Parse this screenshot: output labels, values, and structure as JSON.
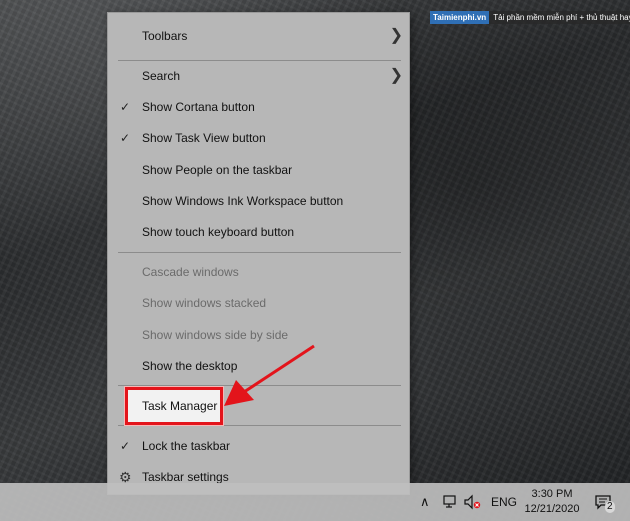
{
  "watermark": {
    "brand": "Taimienphi.vn",
    "tagline": "Tải phần mềm miễn phí + thủ thuật hay"
  },
  "menu": {
    "toolbars": "Toolbars",
    "search": "Search",
    "show_cortana": "Show Cortana button",
    "show_task_view": "Show Task View button",
    "show_people": "Show People on the taskbar",
    "show_ink": "Show Windows Ink Workspace button",
    "show_touch_keyboard": "Show touch keyboard button",
    "cascade": "Cascade windows",
    "stacked": "Show windows stacked",
    "side_by_side": "Show windows side by side",
    "show_desktop": "Show the desktop",
    "task_manager": "Task Manager",
    "lock_taskbar": "Lock the taskbar",
    "taskbar_settings": "Taskbar settings"
  },
  "taskbar": {
    "language": "ENG",
    "time": "3:30 PM",
    "date": "12/21/2020",
    "notification_count": "2"
  },
  "colors": {
    "highlight": "#e3141b",
    "menu_bg": "#b7b7b7"
  },
  "icons": {
    "check": "check-icon",
    "submenu": "chevron-right-icon",
    "settings": "gear-icon"
  }
}
